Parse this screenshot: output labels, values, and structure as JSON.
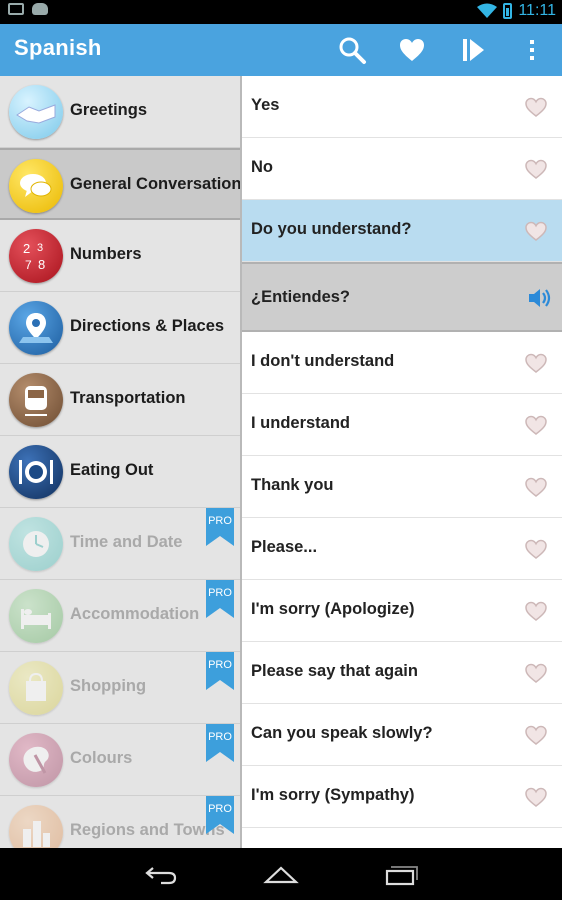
{
  "status_bar": {
    "time": "11:11"
  },
  "action_bar": {
    "title": "Spanish",
    "icons": [
      "search-icon",
      "favorites-heart-icon",
      "play-next-icon",
      "overflow-menu-icon"
    ]
  },
  "categories": [
    {
      "label": "Greetings",
      "icon": "handshake-icon",
      "locked": false,
      "color": "#8fd3ee"
    },
    {
      "label": "General Conversation",
      "icon": "speech-bubbles-icon",
      "locked": false,
      "selected": true,
      "color": "#f5c400"
    },
    {
      "label": "Numbers",
      "icon": "numbers-icon",
      "locked": false,
      "color": "#c9252f"
    },
    {
      "label": "Directions & Places",
      "icon": "map-pin-icon",
      "locked": false,
      "color": "#2a6fb5"
    },
    {
      "label": "Transportation",
      "icon": "train-icon",
      "locked": false,
      "color": "#8b6546"
    },
    {
      "label": "Eating Out",
      "icon": "plate-cutlery-icon",
      "locked": false,
      "color": "#1c4a86"
    },
    {
      "label": "Time and Date",
      "icon": "clock-icon",
      "locked": true,
      "badge": "PRO",
      "color": "#4bc7c2"
    },
    {
      "label": "Accommodation",
      "icon": "bed-icon",
      "locked": true,
      "badge": "PRO",
      "color": "#6bbd6a"
    },
    {
      "label": "Shopping",
      "icon": "shopping-bag-icon",
      "locked": true,
      "badge": "PRO",
      "color": "#e8de5a"
    },
    {
      "label": "Colours",
      "icon": "paint-palette-icon",
      "locked": true,
      "badge": "PRO",
      "color": "#b0456c"
    },
    {
      "label": "Regions and Towns",
      "icon": "city-icon",
      "locked": true,
      "badge": "PRO",
      "color": "#f0a060"
    }
  ],
  "phrases": [
    {
      "text": "Yes"
    },
    {
      "text": "No"
    },
    {
      "text": "Do you understand?",
      "active": true
    },
    {
      "text": "¿Entiendes?",
      "translation": true
    },
    {
      "text": "I don't understand"
    },
    {
      "text": "I understand"
    },
    {
      "text": "Thank you"
    },
    {
      "text": "Please..."
    },
    {
      "text": "I'm sorry (Apologize)"
    },
    {
      "text": "Please say that again"
    },
    {
      "text": "Can you speak slowly?"
    },
    {
      "text": "I'm sorry (Sympathy)"
    }
  ],
  "colors": {
    "action_bar": "#4aa3df",
    "sidebar": "#e4e4e4",
    "selected_category": "#c9c9c9",
    "active_phrase": "#b9dcf0",
    "pro_ribbon": "#3d9fdc",
    "speaker": "#2c8ad8"
  },
  "nav_bar": {
    "icons": [
      "back-icon",
      "home-icon",
      "recent-apps-icon"
    ]
  }
}
